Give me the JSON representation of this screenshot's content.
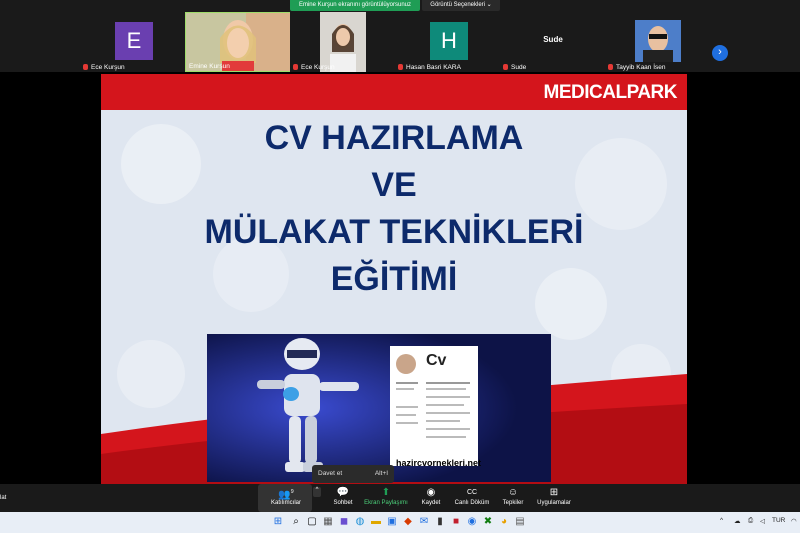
{
  "banner": {
    "sharing_status": "Emine Kurşun ekranını görüntülüyorsunuz",
    "view_options": "Görüntü Seçenekleri"
  },
  "participants": [
    {
      "name": "Ece Kurşun",
      "initial": "E",
      "avatar_color": "#6a3fb0",
      "type": "avatar"
    },
    {
      "name": "Emine Kurşun",
      "type": "video"
    },
    {
      "name": "Ece Kurşun",
      "type": "video"
    },
    {
      "name": "Hasan Basri KARA",
      "initial": "H",
      "avatar_color": "#0e8a7a",
      "type": "avatar"
    },
    {
      "name": "Sude",
      "display_text": "Sude",
      "type": "text"
    },
    {
      "name": "Tayyib Kaan İsen",
      "type": "video"
    }
  ],
  "slide": {
    "brand": "MEDICALPARK",
    "title_lines": [
      "CV HAZIRLAMA",
      "VE",
      "MÜLAKAT TEKNİKLERİ",
      "EĞİTİMİ"
    ],
    "cv_card_title": "Cv",
    "cv_url": "hazircvornekleri.net"
  },
  "tooltip": {
    "label": "Davet et",
    "shortcut": "Alt+I"
  },
  "toolbar": {
    "participants_label": "Katılımcılar",
    "participants_count": "9",
    "chat_label": "Sohbet",
    "share_label": "Ekran Paylaşımı",
    "record_label": "Kaydet",
    "captions_label": "Canlı Döküm",
    "reactions_label": "Tepkiler",
    "apps_label": "Uygulamalar",
    "left_fragment": "lat"
  },
  "taskbar": {
    "language": "TUR"
  },
  "colors": {
    "accent_red": "#d4151c",
    "title_blue": "#0d2a6b",
    "zoom_green": "#1f9d55",
    "zoom_blue": "#1f6fe0"
  }
}
